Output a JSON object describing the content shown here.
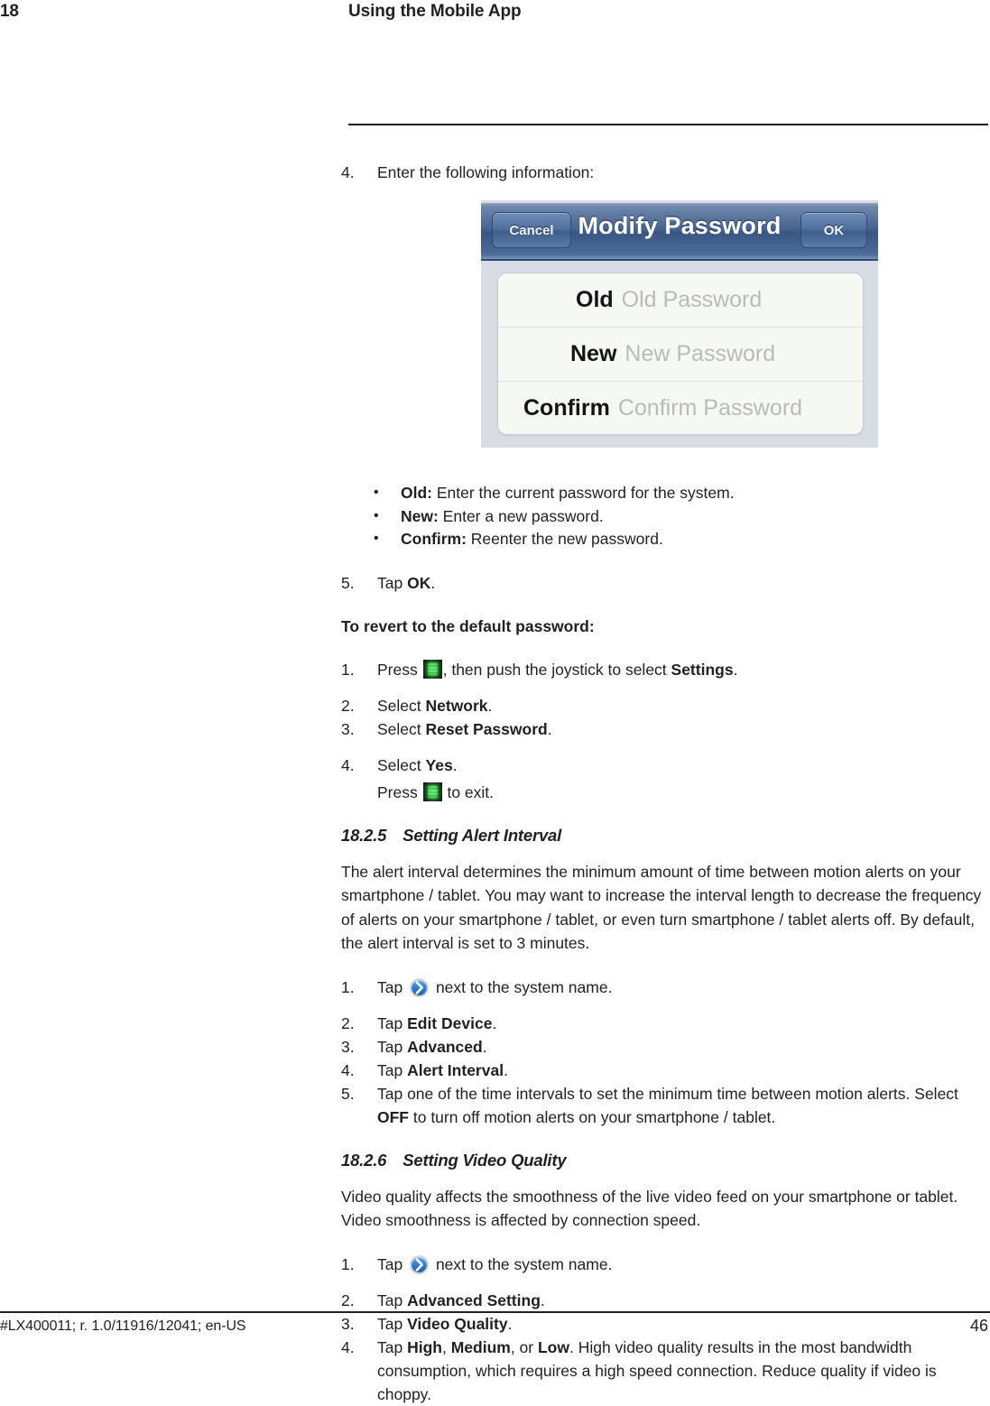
{
  "header": {
    "chapter_number": "18",
    "chapter_title": "Using the Mobile App"
  },
  "steps_top": {
    "step4_marker": "4.",
    "step4_text": "Enter the following information:"
  },
  "app_screenshot": {
    "cancel_label": "Cancel",
    "title": "Modify Password",
    "ok_label": "OK",
    "rows": [
      {
        "label": "Old",
        "placeholder": "Old Password"
      },
      {
        "label": "New",
        "placeholder": "New Password"
      },
      {
        "label": "Confirm",
        "placeholder": "Confirm Password"
      }
    ]
  },
  "field_bullets": [
    {
      "bullet": "•",
      "term": "Old:",
      "desc": " Enter the current password for the system."
    },
    {
      "bullet": "•",
      "term": "New:",
      "desc": " Enter a new password."
    },
    {
      "bullet": "•",
      "term": "Confirm:",
      "desc": " Reenter the new password."
    }
  ],
  "step5": {
    "marker": "5.",
    "pre": "Tap ",
    "bold": "OK",
    "post": "."
  },
  "revert": {
    "heading": "To revert to the default password:",
    "step1": {
      "marker": "1.",
      "pre": "Press ",
      "mid": ", then push the joystick to select ",
      "bold": "Settings",
      "post": "."
    },
    "step2": {
      "marker": "2.",
      "pre": "Select ",
      "bold": "Network",
      "post": "."
    },
    "step3": {
      "marker": "3.",
      "pre": "Select ",
      "bold": "Reset Password",
      "post": "."
    },
    "step4": {
      "marker": "4.",
      "pre": "Select ",
      "bold": "Yes",
      "post": "."
    },
    "step4_sub": {
      "pre": "Press ",
      "post": " to exit."
    }
  },
  "section_alert": {
    "number": "18.2.5",
    "title": "Setting Alert Interval",
    "paragraph": "The alert interval determines the minimum amount of time between motion alerts on your smartphone / tablet. You may want to increase the interval length to decrease the frequency of alerts on your smartphone / tablet, or even turn smartphone / tablet alerts off. By default, the alert interval is set to 3 minutes.",
    "step1": {
      "marker": "1.",
      "pre": "Tap ",
      "post": " next to the system name."
    },
    "step2": {
      "marker": "2.",
      "pre": "Tap ",
      "bold": "Edit Device",
      "post": "."
    },
    "step3": {
      "marker": "3.",
      "pre": "Tap ",
      "bold": "Advanced",
      "post": "."
    },
    "step4": {
      "marker": "4.",
      "pre": "Tap ",
      "bold": "Alert Interval",
      "post": "."
    },
    "step5": {
      "marker": "5.",
      "pre": "Tap one of the time intervals to set the minimum time between motion alerts. Select ",
      "bold": "OFF",
      "post": " to turn off motion alerts on your smartphone / tablet."
    }
  },
  "section_video": {
    "number": "18.2.6",
    "title": "Setting Video Quality",
    "paragraph": "Video quality affects the smoothness of the live video feed on your smartphone or tablet. Video smoothness is affected by connection speed.",
    "step1": {
      "marker": "1.",
      "pre": "Tap ",
      "post": " next to the system name."
    },
    "step2": {
      "marker": "2.",
      "pre": "Tap ",
      "bold": "Advanced Setting",
      "post": "."
    },
    "step3": {
      "marker": "3.",
      "pre": "Tap ",
      "bold": "Video Quality",
      "post": "."
    },
    "step4": {
      "marker": "4.",
      "pre": "Tap ",
      "bold1": "High",
      "sep1": ", ",
      "bold2": "Medium",
      "sep2": ", or ",
      "bold3": "Low",
      "post": ". High video quality results in the most bandwidth consumption, which requires a high speed connection. Reduce quality if video is choppy."
    }
  },
  "footer": {
    "doc_id": "#LX400011; r. 1.0/11916/12041; en-US",
    "page_number": "46"
  },
  "colors": {
    "text": "#231f20",
    "navbar_blue": "#3a5682",
    "icon_blue": "#2f7fd4",
    "icon_green": "#3cdc50",
    "placeholder_gray": "#b7bcbb"
  }
}
